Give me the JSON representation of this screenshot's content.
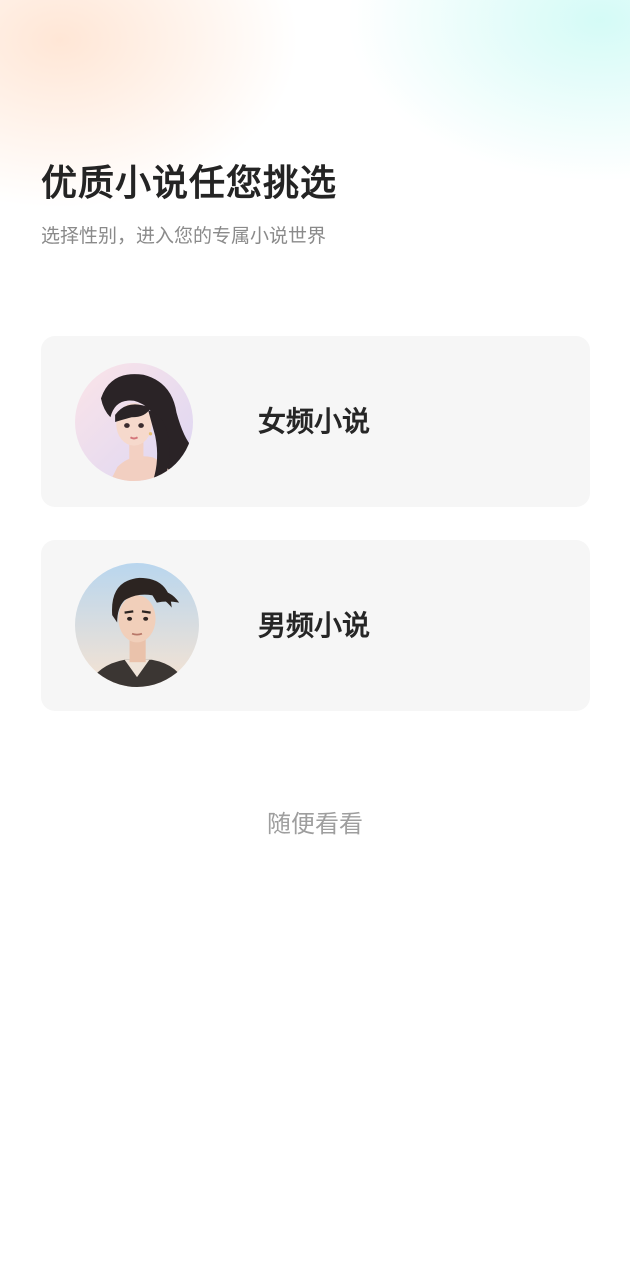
{
  "header": {
    "title": "优质小说任您挑选",
    "subtitle": "选择性别，进入您的专属小说世界"
  },
  "options": [
    {
      "id": "female",
      "label": "女频小说",
      "avatar": "female-portrait-avatar"
    },
    {
      "id": "male",
      "label": "男频小说",
      "avatar": "male-portrait-avatar"
    }
  ],
  "footer": {
    "skip_label": "随便看看"
  },
  "colors": {
    "card_bg": "#f6f6f6",
    "title": "#242424",
    "subtitle": "#8a8a8a",
    "skip": "#9e9e9e"
  }
}
